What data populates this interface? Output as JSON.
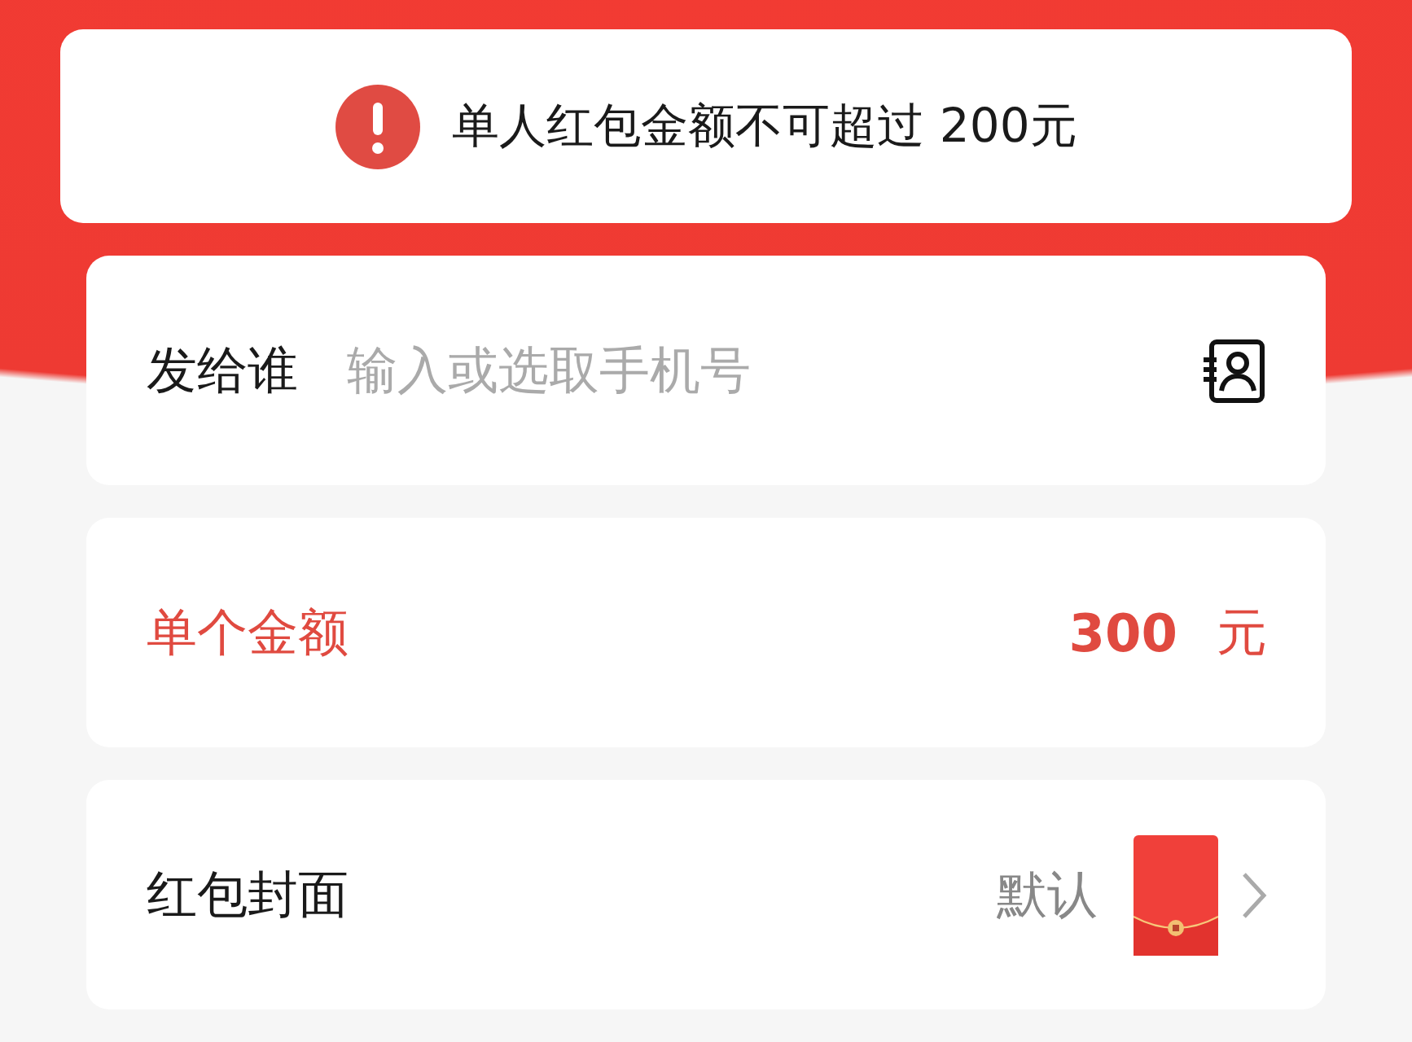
{
  "toast": {
    "message": "单人红包金额不可超过 200元"
  },
  "rows": [
    {
      "kind": "recipient",
      "label": "发给谁",
      "placeholder": "输入或选取手机号"
    },
    {
      "kind": "amount",
      "label": "单个金额",
      "value": "300",
      "unit": "元",
      "error": true
    },
    {
      "kind": "cover",
      "label": "红包封面",
      "value": "默认"
    }
  ]
}
